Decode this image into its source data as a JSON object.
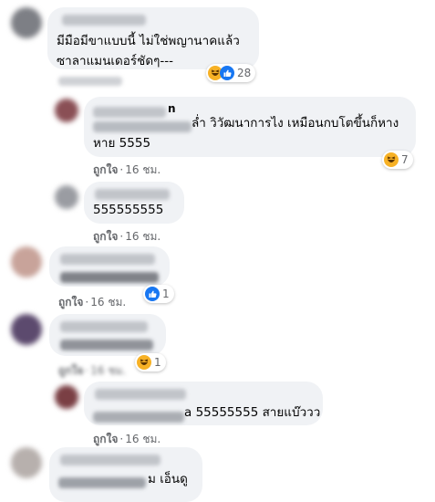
{
  "colors": {
    "bubble": "#f0f2f5",
    "meta": "#65676b",
    "like_blue": "#1877f2",
    "haha_yellow": "#f7b125"
  },
  "comments": [
    {
      "text_lines": [
        "มีมือมีขาแบบนี้ ไม่ใช่พญานาคแล้ว",
        "ซาลาแมนเดอร์ชัดๆ---"
      ],
      "reaction_count": "28",
      "reactions": [
        "haha-icon",
        "like-icon"
      ]
    },
    {
      "name_tail": "n",
      "text_line1_tail": "ล่ำ วิวัฒนาการไง เหมือนกบโตขึ้นก็หาง",
      "text_line2": "หาย 5555",
      "like_label": "ถูกใจ",
      "time": "16 ชม.",
      "reaction_count": "7"
    },
    {
      "text": "555555555",
      "like_label": "ถูกใจ",
      "time": "16 ชม."
    },
    {
      "like_label": "ถูกใจ",
      "time": "16 ชม.",
      "reaction_count": "1"
    },
    {
      "reaction_count": "1",
      "like_label": "ถูกใจ",
      "time": "16 ชม."
    },
    {
      "text_tail": "a 55555555 สายแบ๊ววว",
      "like_label": "ถูกใจ",
      "time": "16 ชม."
    },
    {
      "text_tail": "ม เอ็นดู"
    }
  ]
}
